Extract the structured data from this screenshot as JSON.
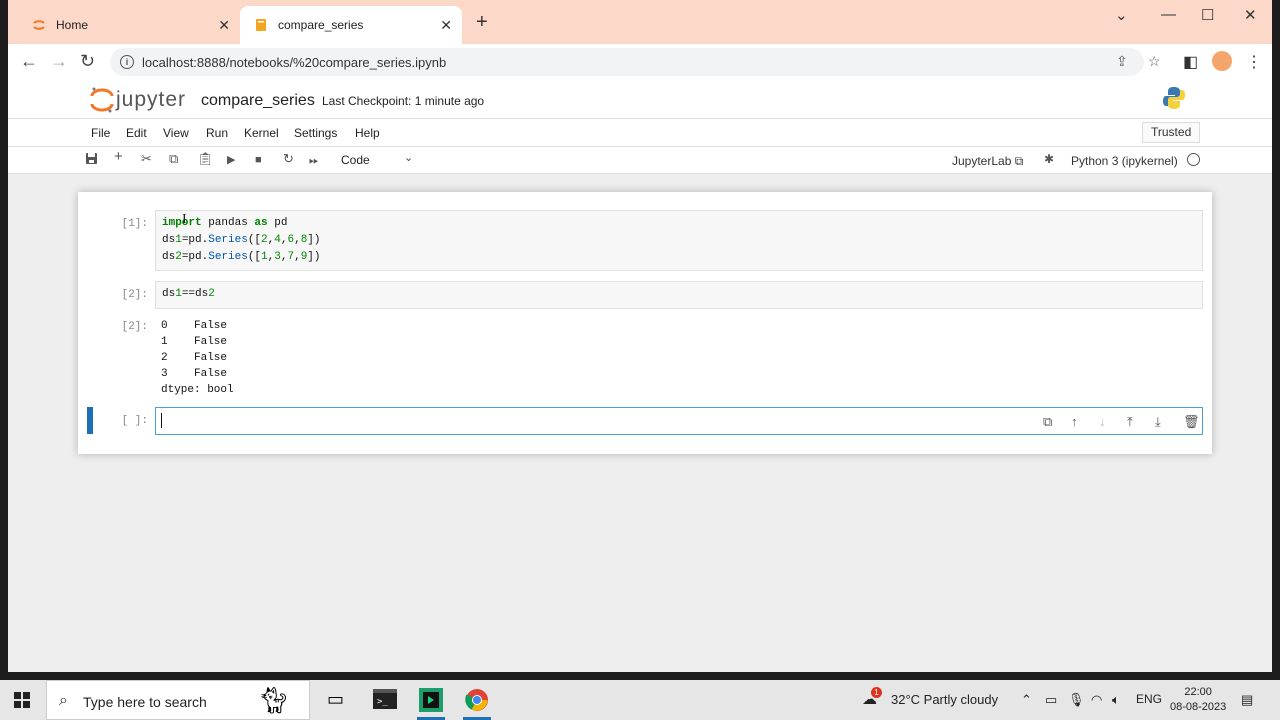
{
  "browser": {
    "tabs": [
      {
        "label": "Home",
        "active": false
      },
      {
        "label": "compare_series",
        "active": true
      }
    ],
    "new_tab_symbol": "+",
    "url": "localhost:8888/notebooks/%20compare_series.ipynb",
    "accent_color": "#fbd8c7"
  },
  "jupyter": {
    "logo_text": "jupyter",
    "notebook_name": "compare_series",
    "checkpoint": "Last Checkpoint: 1 minute ago",
    "menu": [
      "File",
      "Edit",
      "View",
      "Run",
      "Kernel",
      "Settings",
      "Help"
    ],
    "trusted": "Trusted",
    "cell_type": "Code",
    "jupyterlab_link": "JupyterLab",
    "kernel": "Python 3 (ipykernel)"
  },
  "cells": [
    {
      "prompt": "[1]:",
      "lines": [
        "import pandas as pd",
        "ds1=pd.Series([2,4,6,8])",
        "ds2=pd.Series([1,3,7,9])"
      ]
    },
    {
      "prompt": "[2]:",
      "lines": [
        "ds1==ds2"
      ],
      "output_prompt": "[2]:",
      "output": [
        "0    False",
        "1    False",
        "2    False",
        "3    False",
        "dtype: bool"
      ]
    },
    {
      "prompt": "[ ]:",
      "lines": [
        ""
      ]
    }
  ],
  "taskbar": {
    "search_placeholder": "Type here to search",
    "weather": "32°C  Partly cloudy",
    "weather_badge": "1",
    "language": "ENG",
    "time": "22:00",
    "date": "08-08-2023"
  }
}
